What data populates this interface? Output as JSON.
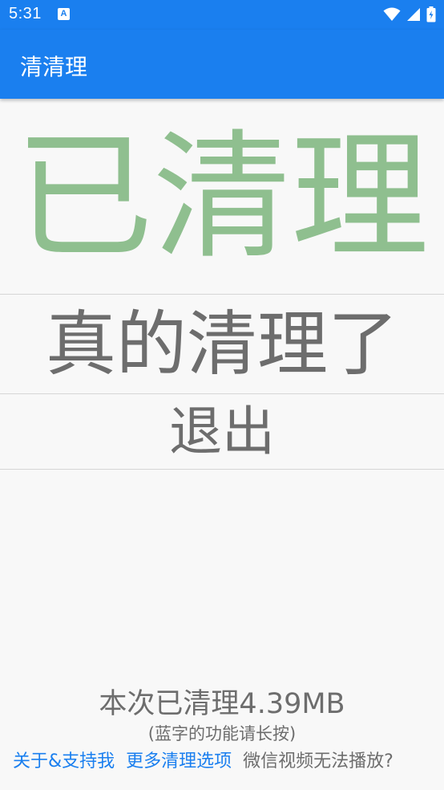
{
  "status_bar": {
    "time": "5:31",
    "notification_icon": "A"
  },
  "app_bar": {
    "title": "清清理"
  },
  "main": {
    "status_text": "已清理",
    "confirm_label": "真的清理了",
    "exit_label": "退出"
  },
  "footer": {
    "summary": "本次已清理4.39MB",
    "hint": "(蓝字的功能请长按)",
    "link_about": "关于&支持我",
    "link_more": "更多清理选项",
    "wechat_video": "微信视频无法播放?"
  },
  "colors": {
    "accent": "#1a7fef",
    "status_green": "#8fbf8f",
    "text_gray": "#6d6d6d"
  },
  "icons": [
    "wifi-icon",
    "cell-signal-icon",
    "battery-icon"
  ]
}
